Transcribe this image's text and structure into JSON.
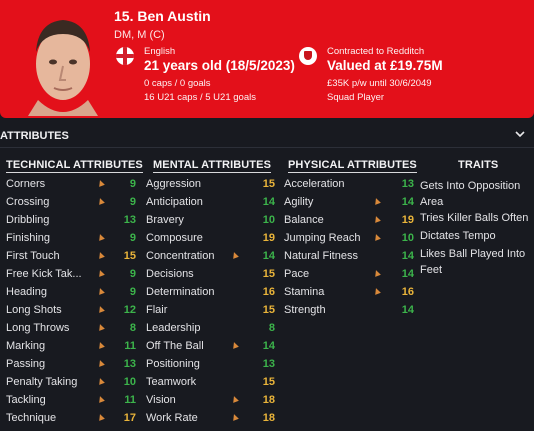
{
  "player": {
    "name": "15. Ben Austin",
    "positions": "DM, M (C)",
    "nationality": "English",
    "age": "21 years old (18/5/2023)",
    "caps": "0 caps / 0 goals",
    "u21": "16 U21 caps / 5 U21 goals",
    "contract": "Contracted to Redditch",
    "value": "Valued at £19.75M",
    "wage": "£35K p/w until 30/6/2049",
    "status": "Squad Player"
  },
  "attributes_title": "ATTRIBUTES",
  "columns": {
    "technical": "TECHNICAL ATTRIBUTES",
    "mental": "MENTAL ATTRIBUTES",
    "physical": "PHYSICAL ATTRIBUTES",
    "traits": "TRAITS"
  },
  "technical": [
    {
      "name": "Corners",
      "value": "9"
    },
    {
      "name": "Crossing",
      "value": "9"
    },
    {
      "name": "Dribbling",
      "value": "13"
    },
    {
      "name": "Finishing",
      "value": "9"
    },
    {
      "name": "First Touch",
      "value": "15"
    },
    {
      "name": "Free Kick Tak...",
      "value": "9"
    },
    {
      "name": "Heading",
      "value": "9"
    },
    {
      "name": "Long Shots",
      "value": "12"
    },
    {
      "name": "Long Throws",
      "value": "8"
    },
    {
      "name": "Marking",
      "value": "11"
    },
    {
      "name": "Passing",
      "value": "13"
    },
    {
      "name": "Penalty Taking",
      "value": "10"
    },
    {
      "name": "Tackling",
      "value": "11"
    },
    {
      "name": "Technique",
      "value": "17"
    }
  ],
  "mental": [
    {
      "name": "Aggression",
      "value": "15"
    },
    {
      "name": "Anticipation",
      "value": "14"
    },
    {
      "name": "Bravery",
      "value": "10"
    },
    {
      "name": "Composure",
      "value": "19"
    },
    {
      "name": "Concentration",
      "value": "14"
    },
    {
      "name": "Decisions",
      "value": "15"
    },
    {
      "name": "Determination",
      "value": "16"
    },
    {
      "name": "Flair",
      "value": "15"
    },
    {
      "name": "Leadership",
      "value": "8"
    },
    {
      "name": "Off The Ball",
      "value": "14"
    },
    {
      "name": "Positioning",
      "value": "13"
    },
    {
      "name": "Teamwork",
      "value": "15"
    },
    {
      "name": "Vision",
      "value": "18"
    },
    {
      "name": "Work Rate",
      "value": "18"
    }
  ],
  "physical": [
    {
      "name": "Acceleration",
      "value": "13"
    },
    {
      "name": "Agility",
      "value": "14"
    },
    {
      "name": "Balance",
      "value": "19"
    },
    {
      "name": "Jumping Reach",
      "value": "10"
    },
    {
      "name": "Natural Fitness",
      "value": "14"
    },
    {
      "name": "Pace",
      "value": "14"
    },
    {
      "name": "Stamina",
      "value": "16"
    },
    {
      "name": "Strength",
      "value": "14"
    }
  ],
  "traits": [
    "Gets Into Opposition Area",
    "Tries Killer Balls Often",
    "Dictates Tempo",
    "Likes Ball Played Into Feet"
  ],
  "colors": {
    "header": "#e3101a",
    "high": "#e9b43a",
    "mid": "#3cb44b",
    "arrow": "#d9893a",
    "bg": "#181a20"
  }
}
